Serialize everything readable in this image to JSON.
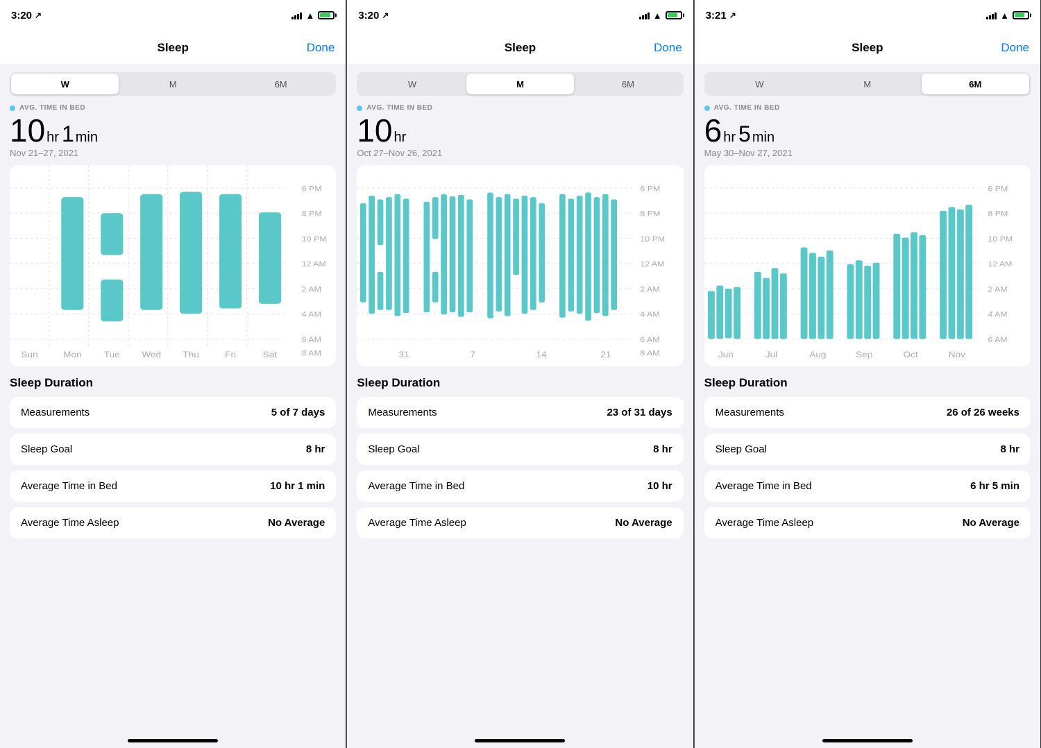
{
  "panels": [
    {
      "id": "panel-week",
      "status": {
        "time": "3:20",
        "location": true
      },
      "nav": {
        "title": "Sleep",
        "done": "Done"
      },
      "segments": [
        "W",
        "M",
        "6M"
      ],
      "activeSegment": 0,
      "avgLabel": "AVG. TIME IN BED",
      "bigStat": {
        "hours": "10",
        "hrUnit": "hr",
        "mins": "1",
        "minUnit": "min"
      },
      "statDate": "Nov 21–27, 2021",
      "chartYLabels": [
        "6 PM",
        "8 PM",
        "10 PM",
        "12 AM",
        "2 AM",
        "4 AM",
        "6 AM",
        "8 AM"
      ],
      "chartXLabels": [
        "Sun",
        "Mon",
        "Tue",
        "Wed",
        "Thu",
        "Fri",
        "Sat"
      ],
      "sleepDuration": {
        "title": "Sleep Duration",
        "items": [
          {
            "label": "Measurements",
            "value": "5 of 7 days"
          },
          {
            "label": "Sleep Goal",
            "value": "8 hr"
          },
          {
            "label": "Average Time in Bed",
            "value": "10 hr 1 min"
          },
          {
            "label": "Average Time Asleep",
            "value": "No Average"
          }
        ]
      }
    },
    {
      "id": "panel-month",
      "status": {
        "time": "3:20",
        "location": true
      },
      "nav": {
        "title": "Sleep",
        "done": "Done"
      },
      "segments": [
        "W",
        "M",
        "6M"
      ],
      "activeSegment": 1,
      "avgLabel": "AVG. TIME IN BED",
      "bigStat": {
        "hours": "10",
        "hrUnit": "hr",
        "mins": "",
        "minUnit": ""
      },
      "statDate": "Oct 27–Nov 26, 2021",
      "chartYLabels": [
        "6 PM",
        "8 PM",
        "10 PM",
        "12 AM",
        "2 AM",
        "4 AM",
        "6 AM",
        "8 AM"
      ],
      "chartXLabels": [
        "31",
        "7",
        "14",
        "21"
      ],
      "sleepDuration": {
        "title": "Sleep Duration",
        "items": [
          {
            "label": "Measurements",
            "value": "23 of 31 days"
          },
          {
            "label": "Sleep Goal",
            "value": "8 hr"
          },
          {
            "label": "Average Time in Bed",
            "value": "10 hr"
          },
          {
            "label": "Average Time Asleep",
            "value": "No Average"
          }
        ]
      }
    },
    {
      "id": "panel-6m",
      "status": {
        "time": "3:21",
        "location": true
      },
      "nav": {
        "title": "Sleep",
        "done": "Done"
      },
      "segments": [
        "W",
        "M",
        "6M"
      ],
      "activeSegment": 2,
      "avgLabel": "AVG. TIME IN BED",
      "bigStat": {
        "hours": "6",
        "hrUnit": "hr",
        "mins": "5",
        "minUnit": "min"
      },
      "statDate": "May 30–Nov 27, 2021",
      "chartYLabels": [
        "6 PM",
        "8 PM",
        "10 PM",
        "12 AM",
        "2 AM",
        "4 AM",
        "6 AM"
      ],
      "chartXLabels": [
        "Jun",
        "Jul",
        "Aug",
        "Sep",
        "Oct",
        "Nov"
      ],
      "sleepDuration": {
        "title": "Sleep Duration",
        "items": [
          {
            "label": "Measurements",
            "value": "26 of 26 weeks"
          },
          {
            "label": "Sleep Goal",
            "value": "8 hr"
          },
          {
            "label": "Average Time in Bed",
            "value": "6 hr 5 min"
          },
          {
            "label": "Average Time Asleep",
            "value": "No Average"
          }
        ]
      }
    }
  ]
}
